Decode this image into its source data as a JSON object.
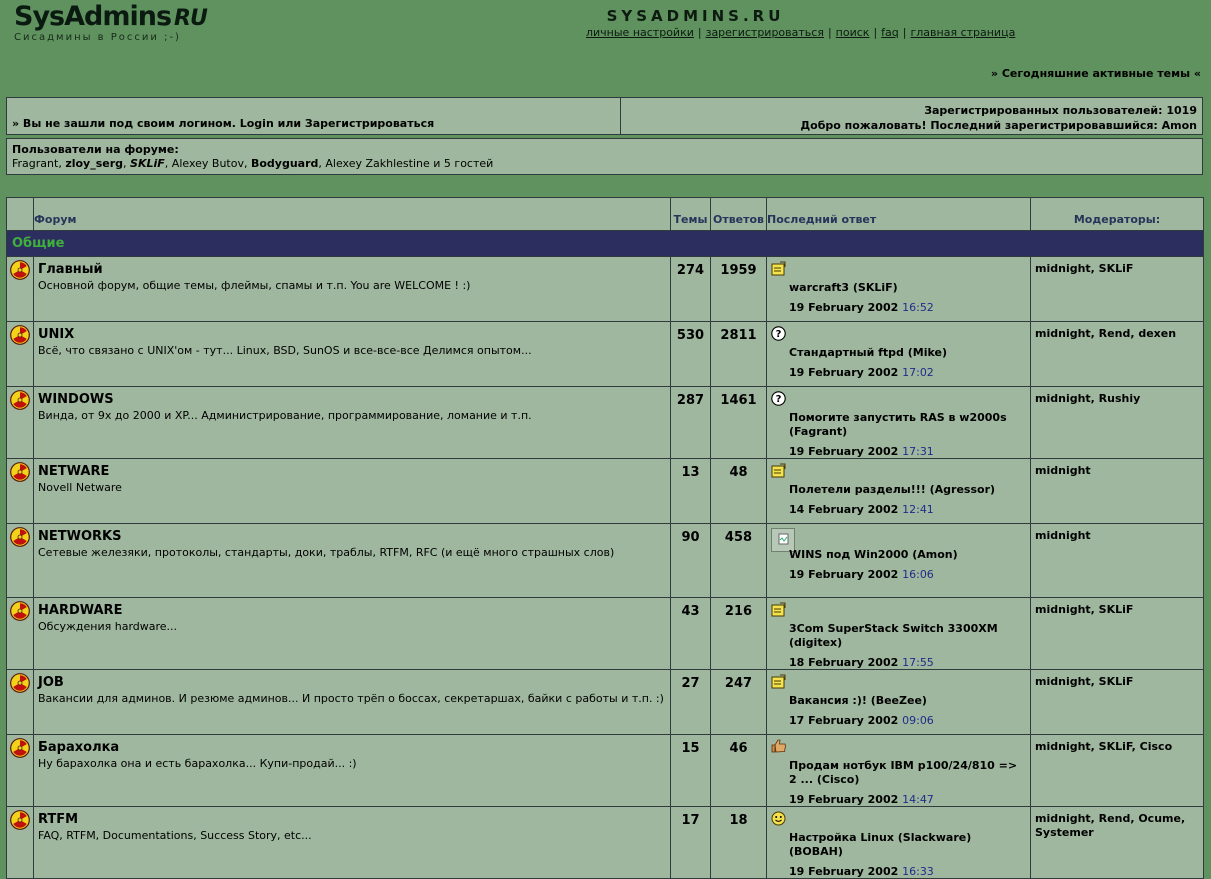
{
  "logo": {
    "word": "SysAdmins",
    "tld": "RU",
    "slogan": "Сисадмины в России ;-)"
  },
  "header": {
    "title": "SYSADMINS.RU",
    "nav": [
      "личные настройки",
      "зарегистрироваться",
      "поиск",
      "faq",
      "главная страница"
    ],
    "active_topics": "» Сегодняшние активные темы «"
  },
  "login": {
    "left": "» Вы не зашли под своим логином. Login или Зарегистрироваться",
    "registered": "Зарегистрированных пользователей: 1019",
    "welcome": "Добро пожаловать! Последний зарегистрировавшийся: Amon"
  },
  "online": {
    "label": "Пользователи на форуме:",
    "users": [
      {
        "name": "Fragrant",
        "style": "normal"
      },
      {
        "name": "zloy_serg",
        "style": "bold"
      },
      {
        "name": "SKLiF",
        "style": "bolditalic"
      },
      {
        "name": "Alexey Butov",
        "style": "normal"
      },
      {
        "name": "Bodyguard",
        "style": "bold"
      },
      {
        "name": "Alexey Zakhlestine",
        "style": "normal"
      }
    ],
    "guests": "и 5 гостей"
  },
  "table": {
    "headers": {
      "forum": "Форум",
      "topics": "Темы",
      "replies": "Ответов",
      "last": "Последний ответ",
      "mods": "Модераторы:"
    },
    "category": "Общие",
    "rows": [
      {
        "name": "Главный",
        "desc": "Основной форум, общие темы, флеймы, спамы и т.п. You are WELCOME ! :)",
        "topics": "274",
        "replies": "1959",
        "post_icon": "note-icon",
        "post": "warcraft3 (SKLiF)",
        "date": "19 February 2002",
        "time": "16:52",
        "mods": "midnight, SKLiF"
      },
      {
        "name": "UNIX",
        "desc": "Всё, что связано с UNIX'ом - тут... Linux, BSD, SunOS и все-все-все Делимся опытом...",
        "topics": "530",
        "replies": "2811",
        "post_icon": "question-icon",
        "post": "Стандартный ftpd (Mike)",
        "date": "19 February 2002",
        "time": "17:02",
        "mods": "midnight, Rend, dexen"
      },
      {
        "name": "WINDOWS",
        "desc": "Винда, от 9х до 2000 и XP... Администрирование, программирование, ломание и т.п.",
        "topics": "287",
        "replies": "1461",
        "post_icon": "question-icon",
        "post": "Помогите запустить RAS в w2000s (Fagrant)",
        "date": "19 February 2002",
        "time": "17:31",
        "mods": "midnight, Rushiy"
      },
      {
        "name": "NETWARE",
        "desc": "Novell Netware",
        "topics": "13",
        "replies": "48",
        "post_icon": "note-icon",
        "post": "Полетели разделы!!! (Agressor)",
        "date": "14 February 2002",
        "time": "12:41",
        "mods": "midnight"
      },
      {
        "name": "NETWORKS",
        "desc": "Сетевые железяки, протоколы, стандарты, доки, траблы, RTFM, RFC (и ещё много страшных слов)",
        "topics": "90",
        "replies": "458",
        "post_icon": "broken-image-icon",
        "post": "WINS под Win2000 (Amon)",
        "date": "19 February 2002",
        "time": "16:06",
        "mods": "midnight"
      },
      {
        "name": "HARDWARE",
        "desc": "Обсуждения hardware...",
        "topics": "43",
        "replies": "216",
        "post_icon": "note-icon",
        "post": "3Com SuperStack Switch 3300XM (digitex)",
        "date": "18 February 2002",
        "time": "17:55",
        "mods": "midnight, SKLiF"
      },
      {
        "name": "JOB",
        "desc": "Вакансии для админов. И резюме админов... И просто трёп о боссах, секретаршах, байки с работы и т.п. :)",
        "topics": "27",
        "replies": "247",
        "post_icon": "note-icon",
        "post": "Вакансия :)! (BeeZee)",
        "date": "17 February 2002",
        "time": "09:06",
        "mods": "midnight, SKLiF"
      },
      {
        "name": "Барахолка",
        "desc": "Ну барахолка она и есть барахолка... Купи-продай... :)",
        "topics": "15",
        "replies": "46",
        "post_icon": "thumb-up-icon",
        "post": "Продам нотбук IBM p100/24/810 => 2 ... (Cisco)",
        "date": "19 February 2002",
        "time": "14:47",
        "mods": "midnight, SKLiF, Cisco"
      },
      {
        "name": "RTFM",
        "desc": "FAQ, RTFM, Documentations, Success Story, etc...",
        "topics": "17",
        "replies": "18",
        "post_icon": "smiley-icon",
        "post": "Настройка Linux (Slackware) (BOBAH)",
        "date": "19 February 2002",
        "time": "16:33",
        "mods": "midnight, Rend, Ocume, Systemer"
      }
    ]
  }
}
